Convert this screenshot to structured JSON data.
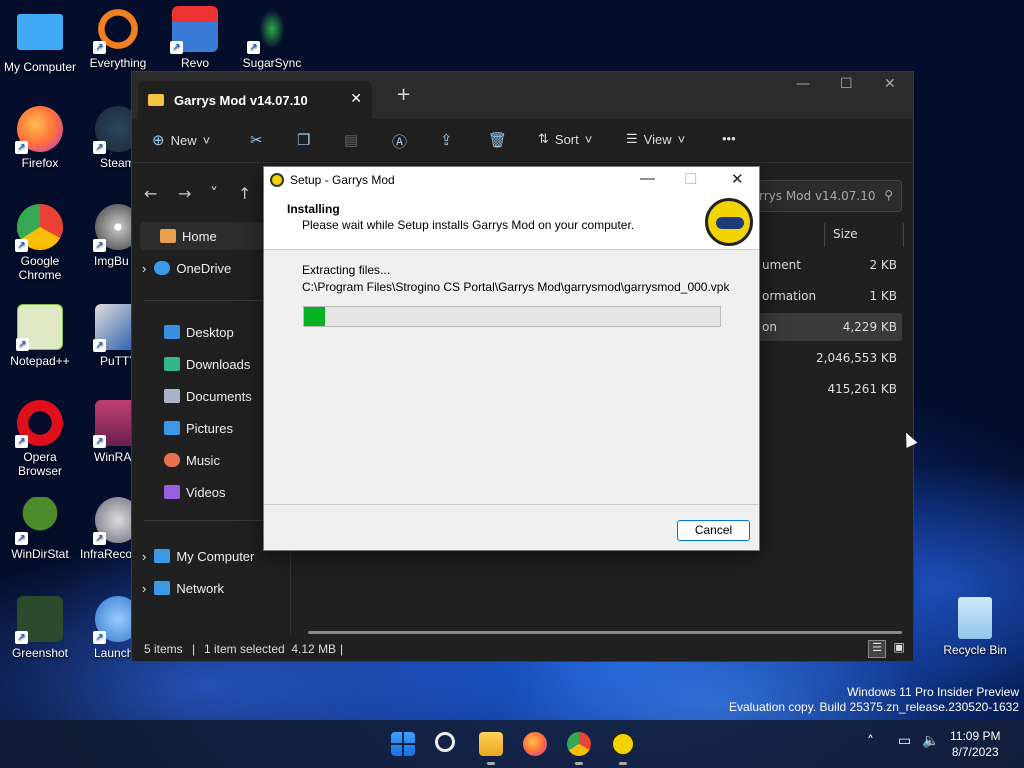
{
  "desktop": {
    "icons": [
      {
        "label": "My Computer",
        "color": "#3fa9f5"
      },
      {
        "label": "Everything",
        "color": "#f08020"
      },
      {
        "label": "Revo",
        "color": "#3a7bd5"
      },
      {
        "label": "SugarSync",
        "color": "#2fa84f"
      },
      {
        "label": "Firefox",
        "color": "#ff7139"
      },
      {
        "label": "Steam",
        "color": "#1b2838"
      },
      {
        "label": "Google Chrome",
        "color": "#4285f4"
      },
      {
        "label": "ImgBu",
        "color": "#888888"
      },
      {
        "label": "Notepad++",
        "color": "#8ac249"
      },
      {
        "label": "PuTTY",
        "color": "#2255aa"
      },
      {
        "label": "Opera Browser",
        "color": "#e0101b"
      },
      {
        "label": "WinRA",
        "color": "#a0306a"
      },
      {
        "label": "WinDirStat",
        "color": "#4c8a2c"
      },
      {
        "label": "InfraReco",
        "color": "#556677"
      },
      {
        "label": "Greenshot",
        "color": "#2c6e2c"
      },
      {
        "label": "Launch",
        "color": "#3377cc"
      },
      {
        "label": "Recycle Bin",
        "color": "#9ad3f5"
      }
    ]
  },
  "explorer": {
    "tab_title": "Garrys Mod v14.07.10",
    "toolbar": {
      "new_label": "New",
      "sort_label": "Sort",
      "view_label": "View",
      "more_label": "•••"
    },
    "search_placeholder": "rrys Mod v14.07.10",
    "sidebar": [
      {
        "label": "Home",
        "color": "#e8a050"
      },
      {
        "label": "OneDrive",
        "color": "#3a9ae8"
      },
      {
        "label": "Desktop",
        "color": "#3a8ee0"
      },
      {
        "label": "Downloads",
        "color": "#35b58a"
      },
      {
        "label": "Documents",
        "color": "#aab4c8"
      },
      {
        "label": "Pictures",
        "color": "#3a9ae8"
      },
      {
        "label": "Music",
        "color": "#e87050"
      },
      {
        "label": "Videos",
        "color": "#9a60e0"
      },
      {
        "label": "My Computer",
        "color": "#3a9ae8"
      },
      {
        "label": "Network",
        "color": "#3a9ae8"
      }
    ],
    "column_size": "Size",
    "rows": [
      {
        "type": "ument",
        "size": "2 KB"
      },
      {
        "type": "ormation",
        "size": "1 KB"
      },
      {
        "type": "on",
        "size": "4,229 KB"
      },
      {
        "type": "",
        "size": "2,046,553 KB"
      },
      {
        "type": "",
        "size": "415,261 KB"
      }
    ],
    "status": {
      "items": "5 items",
      "selected": "1 item selected  4.12 MB"
    }
  },
  "setup": {
    "window_title": "Setup - Garrys Mod",
    "heading": "Installing",
    "subheading": "Please wait while Setup installs Garrys Mod on your computer.",
    "status": "Extracting files...",
    "path": "C:\\Program Files\\Strogino CS Portal\\Garrys Mod\\garrysmod\\garrysmod_000.vpk",
    "progress_percent": 5,
    "cancel_label": "Cancel"
  },
  "watermark": {
    "line1": "Windows 11 Pro Insider Preview",
    "line2": "Evaluation copy. Build 25375.zn_release.230520-1632"
  },
  "clock": {
    "time": "11:09 PM",
    "date": "8/7/2023"
  },
  "taskbar_icons": [
    "windows-start-icon",
    "search-icon",
    "file-explorer-icon",
    "firefox-icon",
    "chrome-icon",
    "garrys-mod-setup-icon"
  ]
}
